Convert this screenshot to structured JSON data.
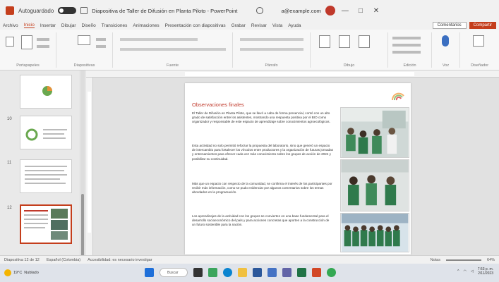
{
  "titlebar": {
    "autosave_label": "Autoguardado",
    "doc_title": "Diapositiva de Taller de Difusión en Planta Piloto - PowerPoint",
    "account": "a@example.com",
    "window_controls": [
      "—",
      "□",
      "✕"
    ]
  },
  "tabs": [
    "Archivo",
    "Inicio",
    "Insertar",
    "Dibujar",
    "Diseño",
    "Transiciones",
    "Animaciones",
    "Presentación con diapositivas",
    "Grabar",
    "Revisar",
    "Vista",
    "Ayuda"
  ],
  "share": {
    "comments": "Comentarios",
    "present": "Compartir"
  },
  "ribbon_groups": [
    "Portapapeles",
    "Diapositivas",
    "Fuente",
    "Párrafo",
    "Dibujo",
    "Edición",
    "Voz",
    "Diseñador"
  ],
  "thumbnails": [
    {
      "num": "",
      "selected": false
    },
    {
      "num": "10",
      "selected": false
    },
    {
      "num": "11",
      "selected": false
    },
    {
      "num": "12",
      "selected": true
    }
  ],
  "slide": {
    "title": "Observaciones finales",
    "paragraphs": [
      "El Taller de Difusión en Planta Piloto, que se llevó a cabo de forma presencial, contó con un alto grado de satisfacción entre los asistentes, mostrando una respuesta positiva por el BIO como organizador y responsable de este espacio de aprendizaje sobre conocimientos agroecológicos.",
      "Esta actividad no solo permitió reforzar la propuesta del laboratorio, sino que generó un espacio de intercambio para fortalecer los vínculos entre productores y la organización de futuras jornadas y entrenamientos para ofrecer cada vez más conocimiento sobre los grupos de acción de 2024 y posibilitar su continuidad.",
      "Más que un espacio con respecto de la comunidad, se confirma el interés de los participantes por recibir más información, como se pudo evidenciar por algunos comentarios sobre los temas abordados en la programación.",
      "Los aprendizajes de la actividad con los grupos se convierten en una base fundamental para el desarrollo socioeconómico del país y para acciones concretas que aporten a la construcción de un futuro sostenible para la nación."
    ]
  },
  "statusbar": {
    "slide_info": "Diapositiva 12 de 12",
    "language": "Español (Colombia)",
    "accessibility": "Accesibilidad: es necesario investigar",
    "notes": "Notas",
    "zoom": "64%"
  },
  "taskbar": {
    "weather_temp": "19°C",
    "weather_desc": "Nublado",
    "search_placeholder": "Buscar",
    "time": "7:53 p. m.",
    "date": "2/11/2023"
  },
  "colors": {
    "accent": "#c43e1c",
    "slide_title": "#c0392b"
  }
}
